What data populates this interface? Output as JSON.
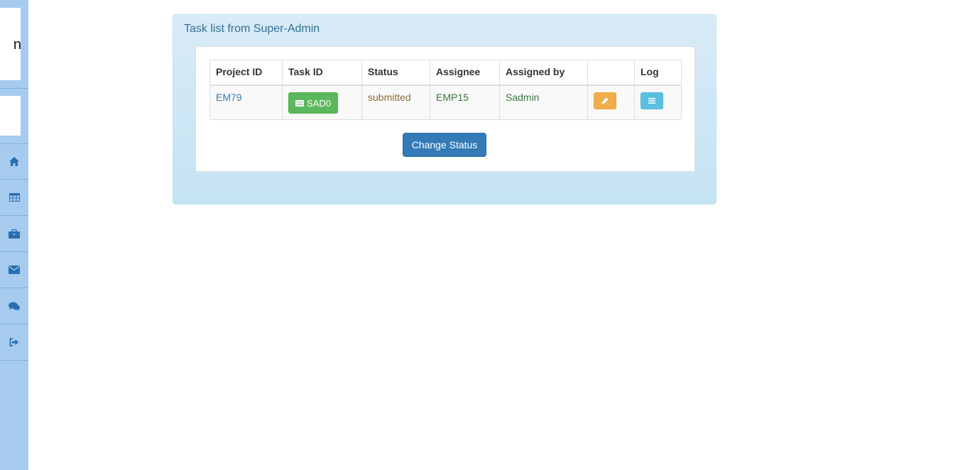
{
  "sidebar": {
    "logo_text": "n",
    "nav_icons": [
      "home-icon",
      "table-icon",
      "briefcase-icon",
      "envelope-icon",
      "comments-icon",
      "sign-out-icon"
    ]
  },
  "panel": {
    "title": "Task list from Super-Admin"
  },
  "table": {
    "headers": [
      "Project ID",
      "Task ID",
      "Status",
      "Assignee",
      "Assigned by",
      "",
      "Log"
    ],
    "rows": [
      {
        "project_id": "EM79",
        "task_id": "SAD0",
        "status": "submitted",
        "assignee": "EMP15",
        "assigned_by": "Sadmin"
      }
    ]
  },
  "actions": {
    "change_status": "Change Status"
  },
  "colors": {
    "sidebar_bg": "#a7cbef",
    "panel_title": "#31708f",
    "btn_primary": "#337ab7",
    "btn_success": "#5cb85c",
    "btn_warning": "#f0ad4e",
    "btn_info": "#5bc0de"
  }
}
